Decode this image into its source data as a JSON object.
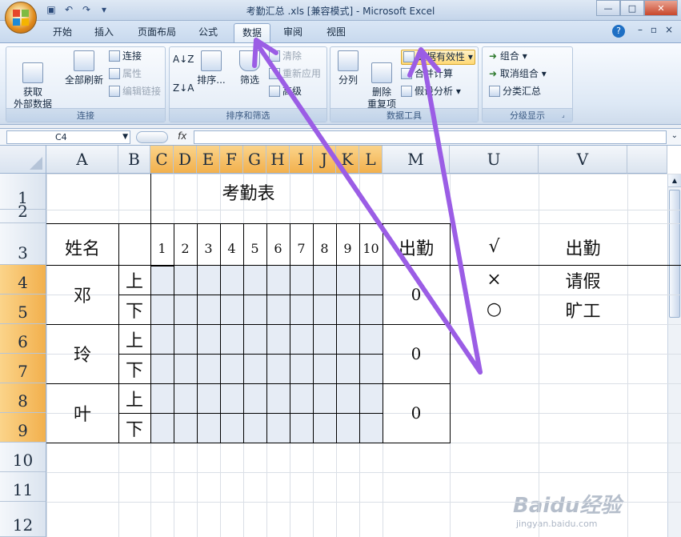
{
  "window": {
    "title": "考勤汇总 .xls  [兼容模式] - Microsoft Excel"
  },
  "tabs": [
    "开始",
    "插入",
    "页面布局",
    "公式",
    "数据",
    "审阅",
    "视图"
  ],
  "active_tab": "数据",
  "ribbon": {
    "connections": {
      "get_external": "获取\n外部数据",
      "refresh_all": "全部刷新",
      "connections": "连接",
      "properties": "属性",
      "edit_links": "编辑链接",
      "label": "连接"
    },
    "sort_filter": {
      "sort": "排序...",
      "filter": "筛选",
      "clear": "清除",
      "reapply": "重新应用",
      "advanced": "高级",
      "label": "排序和筛选"
    },
    "data_tools": {
      "text_to_columns": "分列",
      "remove_duplicates": "删除\n重复项",
      "data_validation": "数据有效性",
      "consolidate": "合并计算",
      "what_if": "假设分析",
      "label": "数据工具"
    },
    "outline": {
      "group": "组合",
      "ungroup": "取消组合",
      "subtotal": "分类汇总",
      "label": "分级显示"
    }
  },
  "formula_bar": {
    "name_box": "C4",
    "fx": "fx",
    "formula": ""
  },
  "columns": [
    "A",
    "B",
    "C",
    "D",
    "E",
    "F",
    "G",
    "H",
    "I",
    "J",
    "K",
    "L",
    "M",
    "U",
    "V"
  ],
  "rows": [
    "1",
    "2",
    "3",
    "4",
    "5",
    "6",
    "7",
    "8",
    "9",
    "10",
    "11",
    "12"
  ],
  "sheet": {
    "title": "考勤表",
    "name_header": "姓名",
    "attendance_header": "出勤",
    "days": [
      "1",
      "2",
      "3",
      "4",
      "5",
      "6",
      "7",
      "8",
      "9",
      "10"
    ],
    "employees": [
      {
        "name": "邓",
        "am": "上",
        "pm": "下",
        "total": "0"
      },
      {
        "name": "玲",
        "am": "上",
        "pm": "下",
        "total": "0"
      },
      {
        "name": "叶",
        "am": "上",
        "pm": "下",
        "total": "0"
      }
    ],
    "legend": [
      {
        "symbol": "√",
        "meaning": "出勤"
      },
      {
        "symbol": "×",
        "meaning": "请假"
      },
      {
        "symbol": "○",
        "meaning": "旷工"
      }
    ]
  },
  "watermark": {
    "logo": "Baidu经验",
    "url": "jingyan.baidu.com"
  },
  "annotation_color": "#9b5de5"
}
